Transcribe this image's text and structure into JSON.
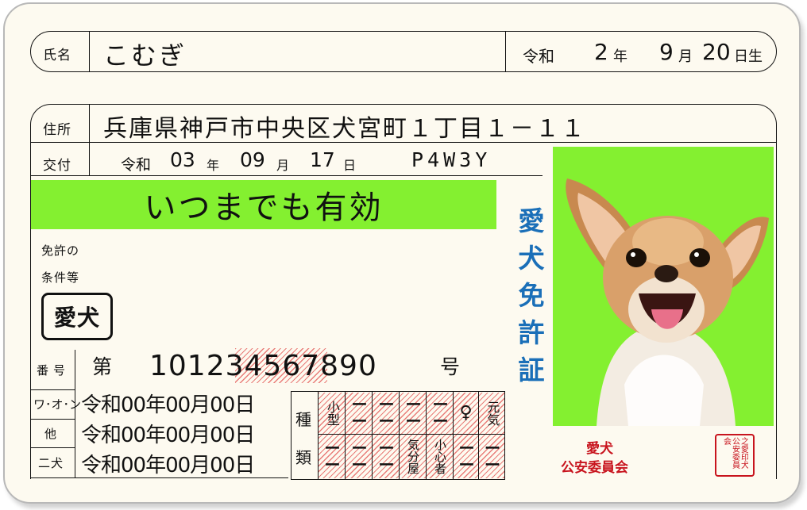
{
  "name": {
    "label": "氏名",
    "value": "こむぎ"
  },
  "birth": {
    "era": "令和",
    "year": "2",
    "year_unit": "年",
    "month": "9",
    "month_unit": "月",
    "day": "20",
    "day_unit": "日生"
  },
  "address": {
    "label": "住所",
    "value": "兵庫県神戸市中央区犬宮町１丁目１－１１"
  },
  "issue": {
    "label": "交付",
    "era": "令和",
    "year": "03",
    "year_unit": "年",
    "month": "09",
    "month_unit": "月",
    "day": "17",
    "day_unit": "日",
    "code": "P4W3Y"
  },
  "validity": {
    "text": "いつまでも有効",
    "color": "#84f030"
  },
  "conditions": {
    "label_line1": "免許の",
    "label_line2": "条件等",
    "badge": "愛犬"
  },
  "license_number": {
    "label": "番号",
    "prefix": "第",
    "digits_a": "1012",
    "digits_b": "3456",
    "digits_c": "7890",
    "suffix": "号"
  },
  "dates": [
    {
      "label": "ワ･オ･ン",
      "value": "令和00年00月00日"
    },
    {
      "label": "他",
      "value": "令和00年00月00日"
    },
    {
      "label": "二犬",
      "value": "令和00年00月00日"
    }
  ],
  "kind": {
    "label_top": "種",
    "label_bottom": "類",
    "row1": [
      "小型",
      "ーー",
      "ーー",
      "ーー",
      "ーー",
      "♀",
      "元気"
    ],
    "row2": [
      "ーー",
      "ーー",
      "ーー",
      "気分屋",
      "小心者",
      "ーー",
      "ーー"
    ]
  },
  "title_vertical": "愛犬免許証",
  "issuer": {
    "line1": "愛犬",
    "line2": "公安委員会"
  },
  "seal": {
    "text": "之愛印犬公安委員会"
  },
  "photo": {
    "background_color": "#84f030",
    "subject": "chihuahua-photo"
  },
  "colors": {
    "title_blue": "#1a6fb8",
    "issuer_red": "#c8141e",
    "hatch_red": "#dc2828"
  }
}
